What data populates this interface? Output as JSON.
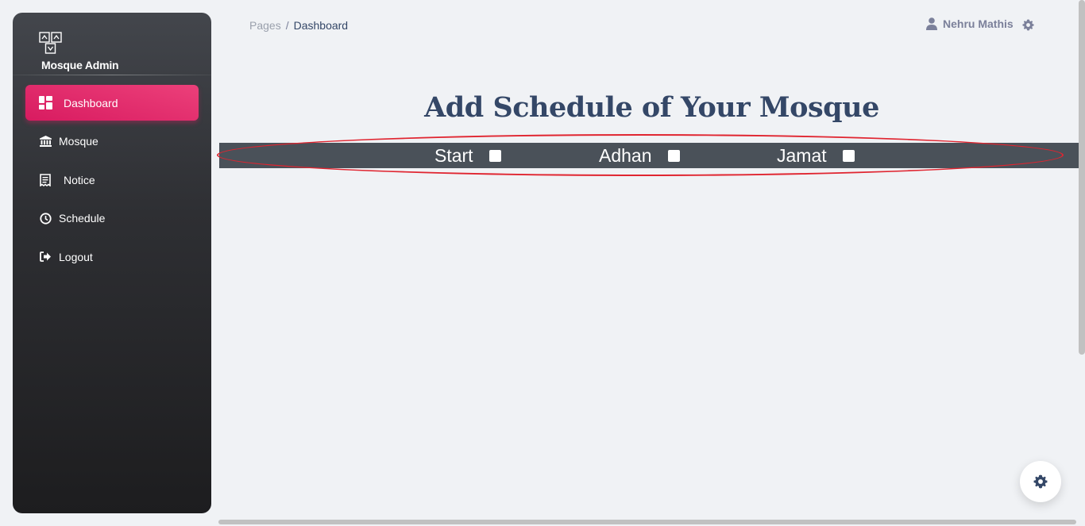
{
  "brand": {
    "name": "Mosque Admin",
    "logo_icon": "mosque-logo-icon"
  },
  "sidebar": {
    "items": [
      {
        "label": "Dashboard",
        "icon": "dashboard-icon",
        "active": true
      },
      {
        "label": "Mosque",
        "icon": "bank-icon",
        "active": false
      },
      {
        "label": "Notice",
        "icon": "receipt-icon",
        "active": false
      },
      {
        "label": "Schedule",
        "icon": "clock-icon",
        "active": false
      },
      {
        "label": "Logout",
        "icon": "logout-icon",
        "active": false
      }
    ]
  },
  "breadcrumb": {
    "parent": "Pages",
    "separator": "/",
    "current": "Dashboard"
  },
  "user": {
    "name": "Nehru Mathis",
    "icon": "user-icon"
  },
  "main": {
    "heading": "Add Schedule of Your Mosque",
    "schedule_fields": [
      {
        "label": "Start",
        "checked": false
      },
      {
        "label": "Adhan",
        "checked": false
      },
      {
        "label": "Jamat",
        "checked": false
      }
    ]
  },
  "colors": {
    "accent": "#e91e63",
    "sidebar_bg": "#2e2f33",
    "heading": "#344767",
    "schedule_bar": "#4a5159",
    "highlight": "#e02530"
  }
}
